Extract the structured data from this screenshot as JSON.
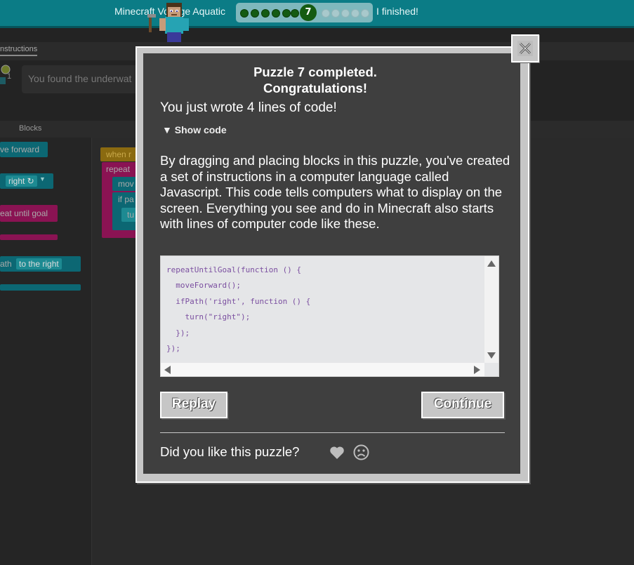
{
  "header": {
    "course_title": "Minecraft Voyage Aquatic",
    "current_level": "7",
    "levels_done_before": 6,
    "levels_after": 5,
    "finished_label": "I finished!"
  },
  "background": {
    "instructions_tab": "nstructions",
    "instructions_text": "You found the underwat",
    "blocks_label": "Blocks",
    "toolbox_blocks": [
      "ve forward",
      "right ↻",
      "eat until goal",
      "ath",
      "to the right"
    ],
    "workspace_blocks": [
      "when r",
      "repeat",
      "mov",
      "if pa",
      "tu"
    ]
  },
  "dialog": {
    "title_line1": "Puzzle 7 completed.",
    "title_line2": "Congratulations!",
    "lines_message": "You just wrote 4 lines of code!",
    "show_code_label": "▼ Show code",
    "explanation": "By dragging and placing blocks in this puzzle, you've created a set of instructions in a computer language called Javascript. This code tells computers what to display on the screen. Everything you see and do in Minecraft also starts with lines of computer code like these.",
    "code_lines": [
      "repeatUntilGoal(function () {",
      "  moveForward();",
      "  ifPath('right', function () {",
      "    turn(\"right\");",
      "  });",
      "});"
    ],
    "replay_label": "Replay",
    "continue_label": "Continue",
    "feedback_question": "Did you like this puzzle?"
  },
  "colors": {
    "header_teal": "#0b7c86",
    "dialog_bg": "#3f3f3f",
    "dialog_frame": "#c6c6c6",
    "code_purple": "#7b4fa0",
    "level_green": "#145b12"
  }
}
